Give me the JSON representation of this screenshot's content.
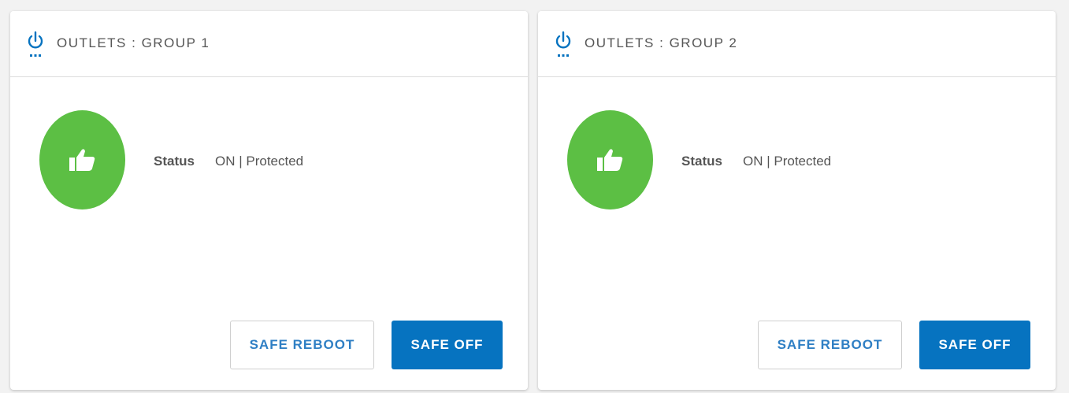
{
  "colors": {
    "accent": "#0673c0",
    "status_ok": "#5cbf44",
    "background": "#f2f2f2"
  },
  "cards": [
    {
      "title": "OUTLETS : GROUP 1",
      "header_icon": "power-icon",
      "status_icon": "thumbs-up-icon",
      "status_label": "Status",
      "status_value": "ON | Protected",
      "buttons": {
        "safe_reboot": "SAFE REBOOT",
        "safe_off": "SAFE OFF"
      }
    },
    {
      "title": "OUTLETS : GROUP 2",
      "header_icon": "power-icon",
      "status_icon": "thumbs-up-icon",
      "status_label": "Status",
      "status_value": "ON | Protected",
      "buttons": {
        "safe_reboot": "SAFE REBOOT",
        "safe_off": "SAFE OFF"
      }
    }
  ]
}
